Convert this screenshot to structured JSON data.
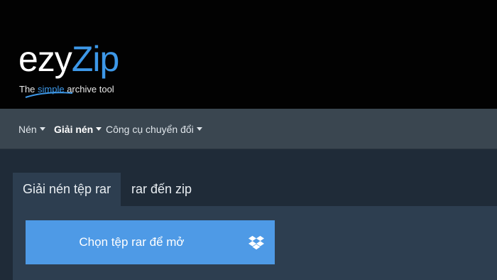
{
  "brand": {
    "logo_prefix": "ezy",
    "logo_suffix": "Zip",
    "tagline_before": "The ",
    "tagline_highlight": "simple",
    "tagline_after": " archive tool",
    "accent_color": "#3d98e8"
  },
  "nav": {
    "items": [
      {
        "label": "Nén",
        "active": false,
        "dropdown": true
      },
      {
        "label": "Giải nén",
        "active": true,
        "dropdown": true
      },
      {
        "label": "Công cụ chuyển đổi",
        "active": false,
        "dropdown": true
      }
    ]
  },
  "tabs": [
    {
      "label": "Giải nén tệp rar",
      "active": true
    },
    {
      "label": "rar đến zip",
      "active": false
    }
  ],
  "main": {
    "choose_button_label": "Chọn tệp rar để mở",
    "choose_button_color": "#4e9ae6",
    "dropbox_icon": "dropbox-icon"
  }
}
